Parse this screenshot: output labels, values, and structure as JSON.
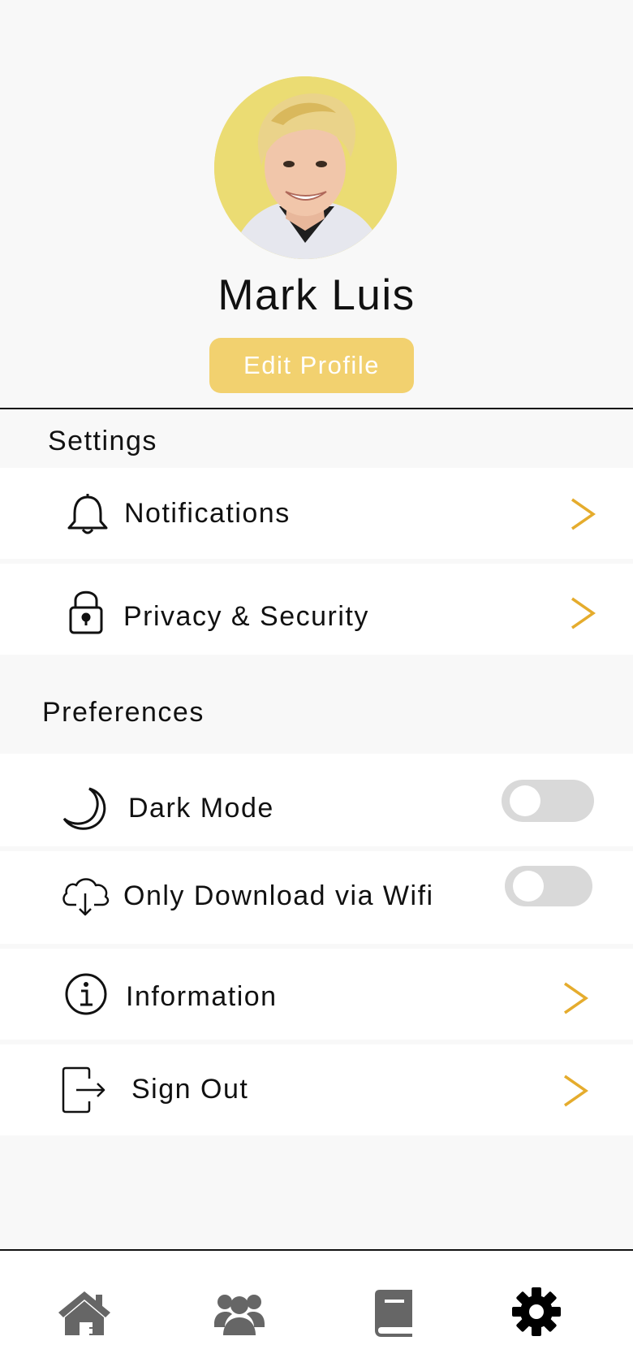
{
  "profile": {
    "name": "Mark Luis",
    "edit_label": "Edit Profile"
  },
  "settings": {
    "title": "Settings",
    "items": [
      {
        "label": "Notifications",
        "icon": "bell-icon"
      },
      {
        "label": "Privacy & Security",
        "icon": "lock-icon"
      }
    ]
  },
  "preferences": {
    "title": "Preferences",
    "items": [
      {
        "label": "Dark Mode",
        "icon": "moon-icon",
        "toggle": false
      },
      {
        "label": "Only Download via Wifi",
        "icon": "cloud-download-icon",
        "toggle": false
      },
      {
        "label": "Information",
        "icon": "info-icon"
      },
      {
        "label": "Sign Out",
        "icon": "sign-out-icon"
      }
    ]
  },
  "bottom_nav": [
    {
      "name": "home",
      "icon": "home-icon",
      "active": false
    },
    {
      "name": "community",
      "icon": "users-icon",
      "active": false
    },
    {
      "name": "library",
      "icon": "book-icon",
      "active": false
    },
    {
      "name": "settings",
      "icon": "gear-icon",
      "active": true
    }
  ],
  "colors": {
    "accent": "#e5ac2d",
    "button": "#f2d16f",
    "avatar_bg": "#ebdc73",
    "nav_inactive": "#666666",
    "nav_active": "#000000"
  }
}
